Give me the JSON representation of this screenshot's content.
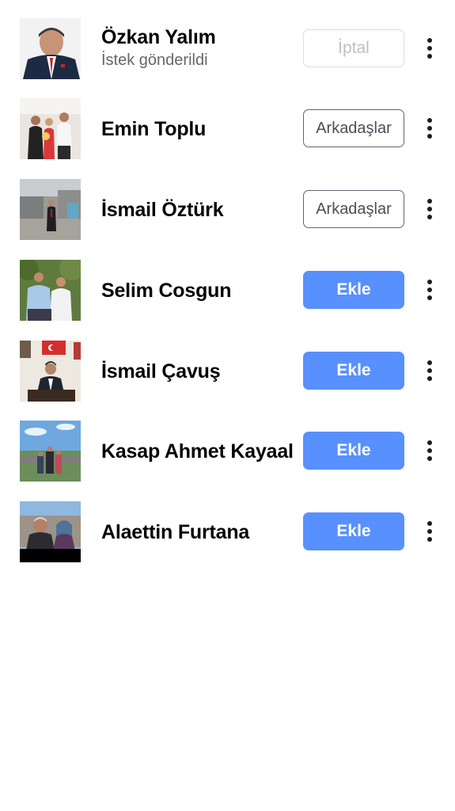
{
  "friends": [
    {
      "name": "Özkan Yalım",
      "subtitle": "İstek gönderildi",
      "action": "İptal",
      "action_type": "cancel"
    },
    {
      "name": "Emin Toplu",
      "subtitle": "",
      "action": "Arkadaşlar",
      "action_type": "friends"
    },
    {
      "name": "İsmail Öztürk",
      "subtitle": "",
      "action": "Arkadaşlar",
      "action_type": "friends"
    },
    {
      "name": "Selim Cosgun",
      "subtitle": "",
      "action": "Ekle",
      "action_type": "add"
    },
    {
      "name": "İsmail Çavuş",
      "subtitle": "",
      "action": "Ekle",
      "action_type": "add"
    },
    {
      "name": "Kasap Ahmet Kayaal",
      "subtitle": "",
      "action": "Ekle",
      "action_type": "add"
    },
    {
      "name": "Alaettin Furtana",
      "subtitle": "",
      "action": "Ekle",
      "action_type": "add"
    }
  ],
  "icons": {
    "more": "more-vertical-icon"
  },
  "colors": {
    "add_button": "#5890ff",
    "text": "#050505",
    "subtitle": "#65676b"
  }
}
